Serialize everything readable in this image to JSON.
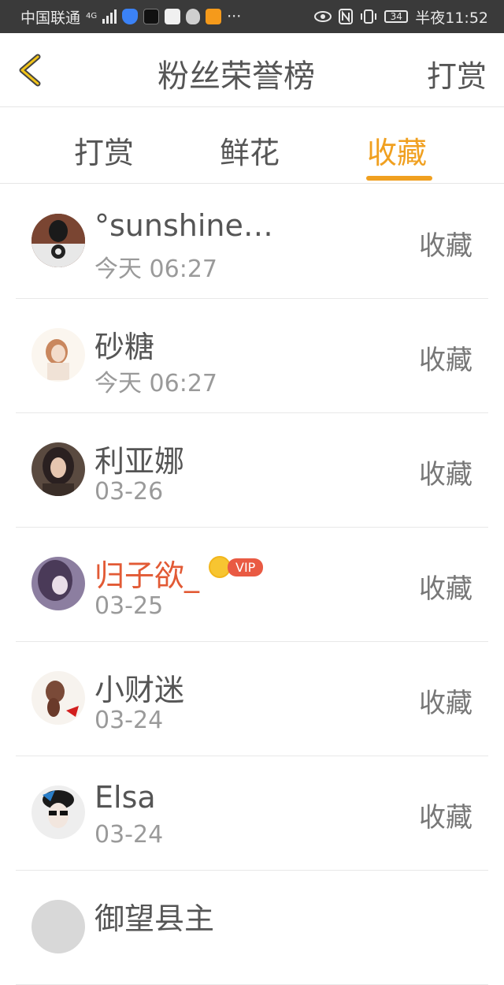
{
  "status_bar": {
    "carrier": "中国联通",
    "network": "4G",
    "time": "半夜11:52",
    "battery": "34"
  },
  "header": {
    "title": "粉丝荣誉榜",
    "right_action": "打赏"
  },
  "tabs": [
    {
      "label": "打赏",
      "active": false
    },
    {
      "label": "鲜花",
      "active": false
    },
    {
      "label": "收藏",
      "active": true
    }
  ],
  "colors": {
    "accent": "#f0a020",
    "vip_name": "#e25a35"
  },
  "list": [
    {
      "name": "°sunshine…",
      "date": "今天 06:27",
      "action": "收藏"
    },
    {
      "name": "砂糖",
      "date": "今天 06:27",
      "action": "收藏"
    },
    {
      "name": "利亚娜",
      "date": "03-26",
      "action": "收藏"
    },
    {
      "name": "归子欲_",
      "date": "03-25",
      "action": "收藏",
      "vip": "VIP"
    },
    {
      "name": "小财迷",
      "date": "03-24",
      "action": "收藏"
    },
    {
      "name": "Elsa",
      "date": "03-24",
      "action": "收藏"
    },
    {
      "name": "御望县主",
      "date": "",
      "action": ""
    }
  ]
}
